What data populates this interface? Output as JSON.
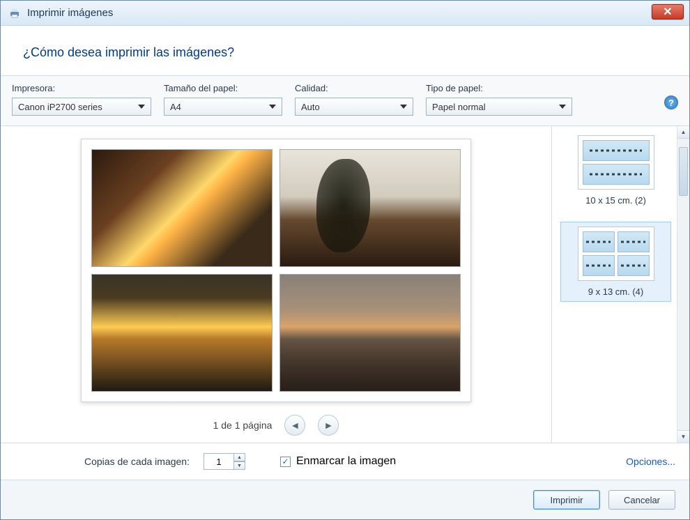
{
  "window": {
    "title": "Imprimir imágenes"
  },
  "question": "¿Cómo desea imprimir las imágenes?",
  "options": {
    "printer_label": "Impresora:",
    "printer_value": "Canon iP2700 series",
    "paper_size_label": "Tamaño del papel:",
    "paper_size_value": "A4",
    "quality_label": "Calidad:",
    "quality_value": "Auto",
    "paper_type_label": "Tipo de papel:",
    "paper_type_value": "Papel normal"
  },
  "pager": {
    "text": "1 de 1 página"
  },
  "layouts": {
    "items": [
      {
        "label": "10 x 15 cm. (2)",
        "selected": false,
        "grid": "two"
      },
      {
        "label": "9 x 13 cm. (4)",
        "selected": true,
        "grid": "four"
      }
    ]
  },
  "footer": {
    "copies_label": "Copias de cada imagen:",
    "copies_value": "1",
    "fit_label": "Enmarcar la imagen",
    "fit_checked": true,
    "options_link": "Opciones..."
  },
  "buttons": {
    "print": "Imprimir",
    "cancel": "Cancelar"
  },
  "icons": {
    "help": "?",
    "check": "✓",
    "close": "✕",
    "prev": "◄",
    "next": "►",
    "up": "▲",
    "down": "▼"
  }
}
